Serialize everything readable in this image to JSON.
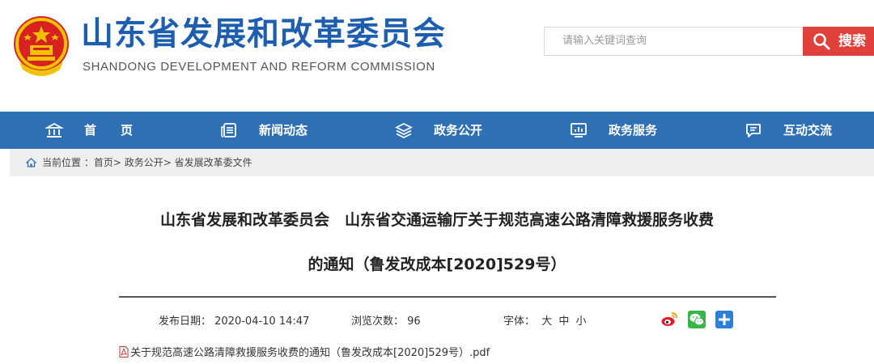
{
  "header": {
    "title": "山东省发展和改革委员会",
    "subtitle": "SHANDONG DEVELOPMENT AND REFORM COMMISSION",
    "brand_color": "#1d5fae"
  },
  "search": {
    "placeholder": "请输入关键词查询",
    "button_label": "搜索",
    "button_color": "#e0413b"
  },
  "nav": {
    "bg_color": "#2f6fb3",
    "items": [
      {
        "label": "首　　页",
        "icon": "home-icon"
      },
      {
        "label": "新闻动态",
        "icon": "news-icon"
      },
      {
        "label": "政务公开",
        "icon": "layers-icon"
      },
      {
        "label": "政务服务",
        "icon": "monitor-chart-icon"
      },
      {
        "label": "互动交流",
        "icon": "chat-icon"
      }
    ]
  },
  "breadcrumb": {
    "prefix": "当前位置 ：",
    "items": [
      "首页",
      "政务公开",
      "省发展改革委文件"
    ],
    "separator": "> "
  },
  "article": {
    "title_line1": "山东省发展和改革委员会　山东省交通运输厅关于规范高速公路清障救援服务收费",
    "title_line2": "的通知（鲁发改成本[2020]529号）",
    "publish_label": "发布日期：",
    "publish_date": "2020-04-10 14:47",
    "views_label": "浏览次数：",
    "views_count": "96",
    "font_label": "字体：",
    "font_sizes": [
      "大",
      "中",
      "小"
    ],
    "share_icons": [
      "weibo-icon",
      "wechat-icon",
      "plus-share-icon"
    ],
    "attachment": "关于规范高速公路清障救援服务收费的通知（鲁发改成本[2020]529号）.pdf"
  }
}
